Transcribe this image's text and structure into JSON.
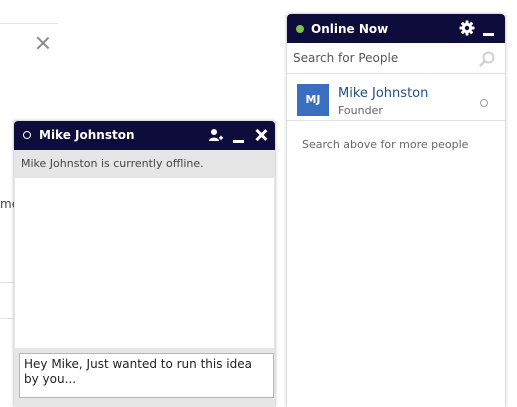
{
  "background": {
    "partial_text": "me"
  },
  "chat_window": {
    "title": "Mike Johnston",
    "offline_note": "Mike Johnston is currently offline.",
    "composer_value": "Hey Mike, Just wanted to run this idea by you...",
    "icons": [
      "status-ring-icon",
      "add-person-icon",
      "minimize-icon",
      "close-icon"
    ]
  },
  "online_panel": {
    "title": "Online Now",
    "status_color": "#7bc24a",
    "search_placeholder": "Search for People",
    "people": [
      {
        "initials": "MJ",
        "name": "Mike Johnston",
        "role": "Founder",
        "avatar_color": "#3a6fc0"
      }
    ],
    "hint": "Search above for more people",
    "icons": [
      "gear-icon",
      "minimize-icon",
      "search-icon"
    ]
  },
  "colors": {
    "header_bg": "#0d0c3b",
    "accent_link": "#1f4f86"
  }
}
